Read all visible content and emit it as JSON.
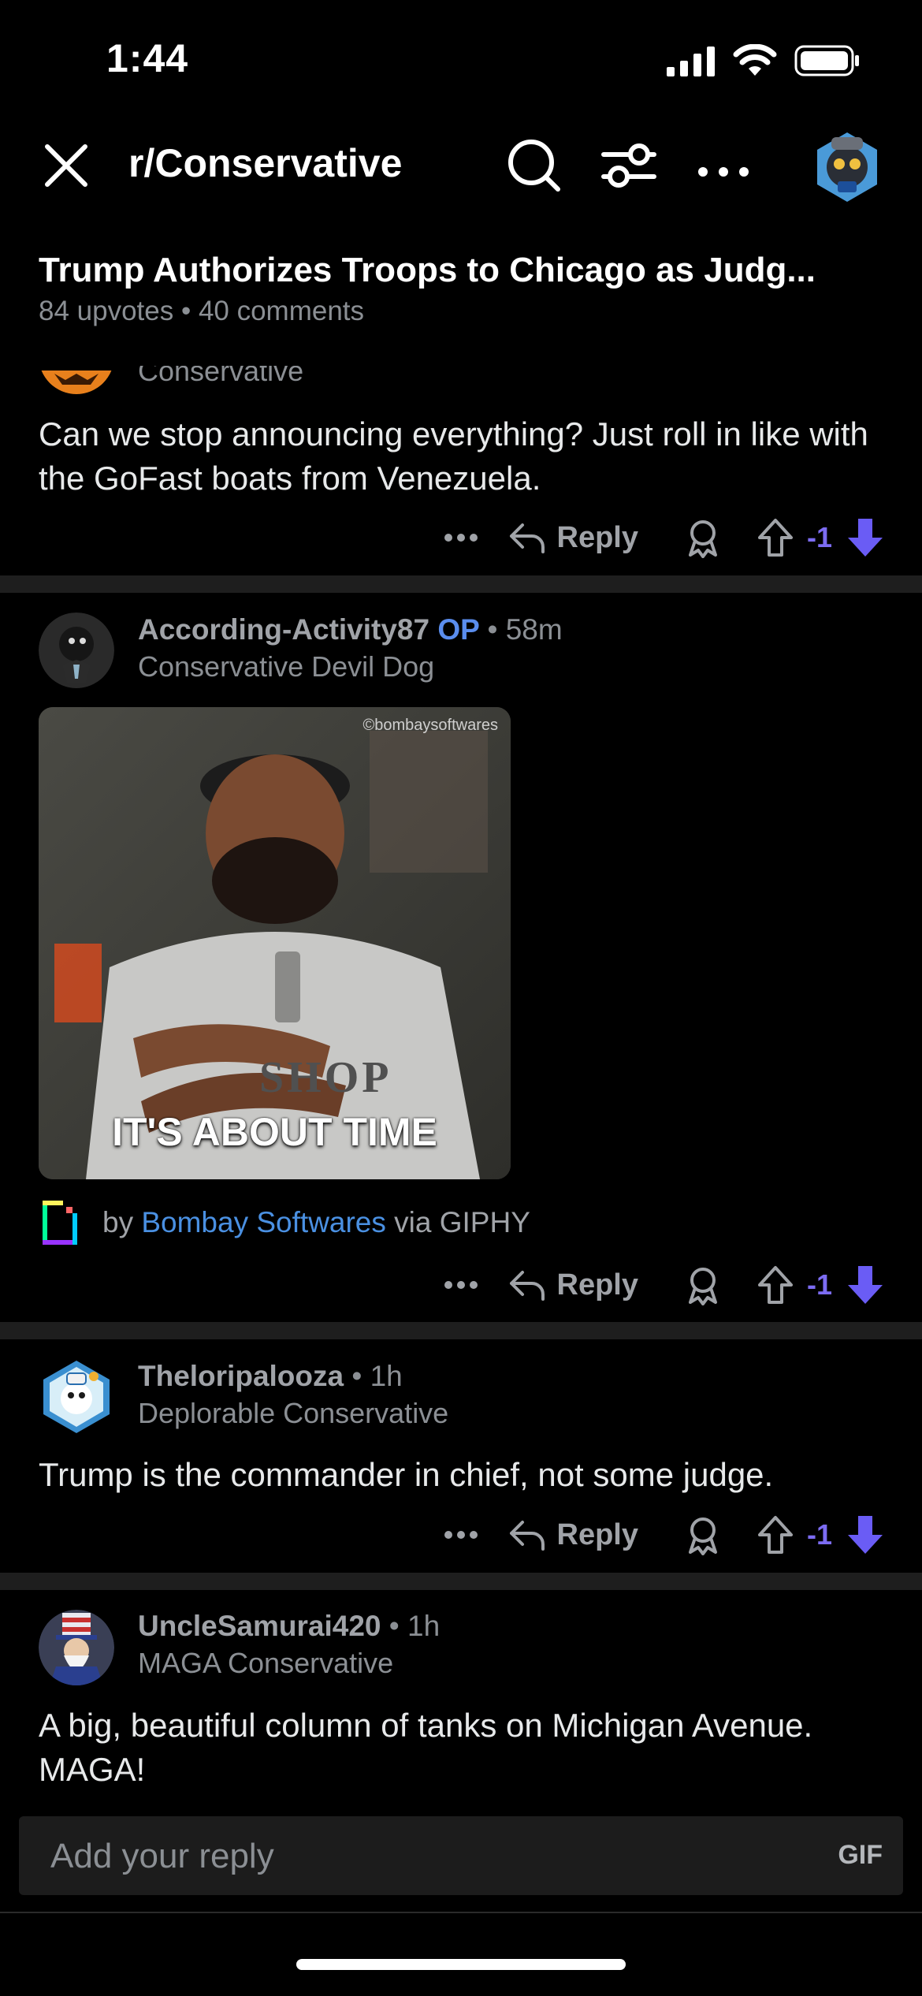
{
  "status": {
    "time": "1:44"
  },
  "header": {
    "subreddit": "r/Conservative"
  },
  "post": {
    "title": "Trump Authorizes Troops to Chicago as Judg...",
    "meta": "84 upvotes • 40 comments"
  },
  "comments": [
    {
      "flair": "Conservative",
      "body": "Can we stop announcing everything? Just roll in like with the GoFast boats from Venezuela.",
      "actions": {
        "reply_label": "Reply",
        "score": "-1"
      }
    },
    {
      "user": "According-Activity87",
      "op_badge": "OP",
      "sep": "•",
      "age": "58m",
      "flair": "Conservative Devil Dog",
      "gif": {
        "caption": "IT'S ABOUT TIME",
        "watermark": "©bombaysoftwares",
        "shirt_text": "SHOP"
      },
      "giphy": {
        "by": "by",
        "author": "Bombay Softwares",
        "via": "via GIPHY"
      },
      "actions": {
        "reply_label": "Reply",
        "score": "-1"
      }
    },
    {
      "user": "Theloripalooza",
      "sep": "•",
      "age": "1h",
      "flair": "Deplorable Conservative",
      "body": "Trump is the commander in chief, not some judge.",
      "actions": {
        "reply_label": "Reply",
        "score": "-1"
      }
    },
    {
      "user": "UncleSamurai420",
      "sep": "•",
      "age": "1h",
      "flair": "MAGA Conservative",
      "body": "A big, beautiful column of tanks on Michigan Avenue. MAGA!"
    }
  ],
  "reply_bar": {
    "placeholder": "Add your reply",
    "gif_label": "GIF"
  },
  "colors": {
    "downvote": "#6a5cf5",
    "score": "#7c6cf2",
    "link": "#4a90e2",
    "op": "#5a8dee"
  },
  "icons": [
    "signal-icon",
    "wifi-icon",
    "battery-icon",
    "close-icon",
    "search-icon",
    "filter-icon",
    "more-icon",
    "reply-arrow-icon",
    "award-icon",
    "upvote-icon",
    "downvote-icon",
    "giphy-icon"
  ]
}
